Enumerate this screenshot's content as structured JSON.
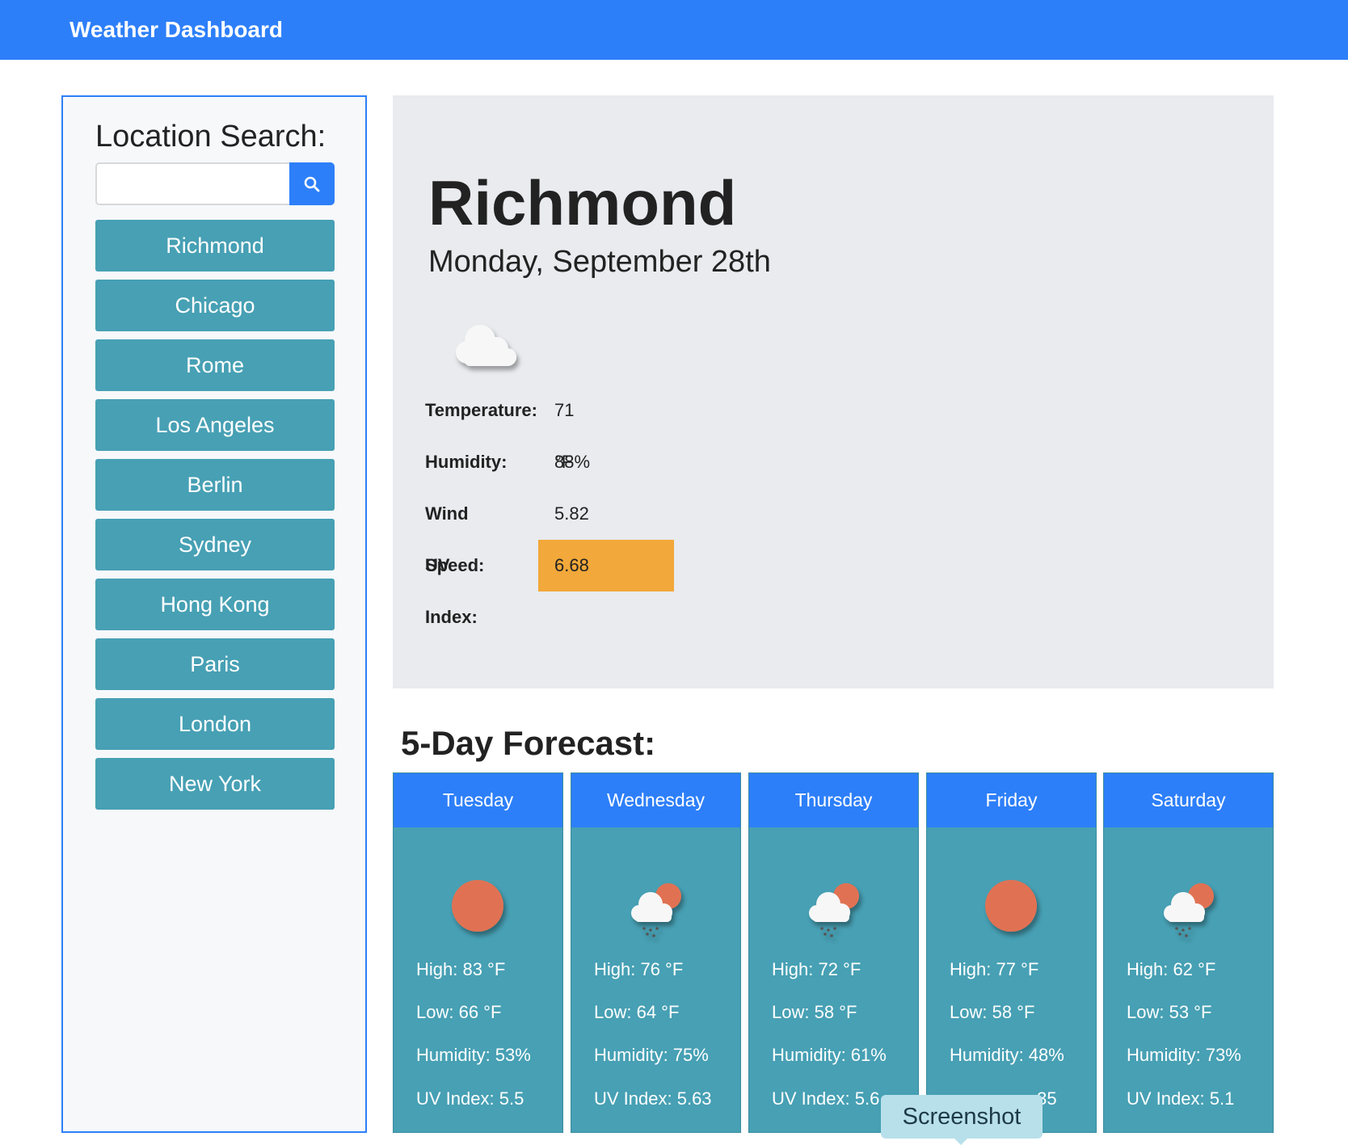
{
  "navbar": {
    "title": "Weather Dashboard"
  },
  "sidebar": {
    "heading": "Location Search:",
    "search": {
      "value": "",
      "placeholder": "",
      "button_icon": "search-icon"
    },
    "cities": [
      "Richmond",
      "Chicago",
      "Rome",
      "Los Angeles",
      "Berlin",
      "Sydney",
      "Hong Kong",
      "Paris",
      "London",
      "New York"
    ]
  },
  "current": {
    "city": "Richmond",
    "date": "Monday, September 28th",
    "icon": "cloud-icon",
    "temperature_label": "Temperature:",
    "temperature": "71 °F",
    "humidity_label": "Humidity:",
    "humidity": "88%",
    "wind_label": "Wind Speed:",
    "wind": "5.82 MPH",
    "uv_label": "UV Index:",
    "uv": "6.68",
    "uv_color": "#f2a83a"
  },
  "forecast": {
    "title": "5-Day Forecast:",
    "days": [
      {
        "day": "Tuesday",
        "icon": "sun-icon",
        "high": "High: 83 °F",
        "low": "Low: 66 °F",
        "humidity": "Humidity: 53%",
        "uv": "UV Index: 5.5"
      },
      {
        "day": "Wednesday",
        "icon": "rain-cloud-sun-icon",
        "high": "High: 76 °F",
        "low": "Low: 64 °F",
        "humidity": "Humidity: 75%",
        "uv": "UV Index: 5.63"
      },
      {
        "day": "Thursday",
        "icon": "rain-cloud-sun-icon",
        "high": "High: 72 °F",
        "low": "Low: 58 °F",
        "humidity": "Humidity: 61%",
        "uv": "UV Index: 5.6"
      },
      {
        "day": "Friday",
        "icon": "sun-icon",
        "high": "High: 77 °F",
        "low": "Low: 58 °F",
        "humidity": "Humidity: 48%",
        "uv": ".35"
      },
      {
        "day": "Saturday",
        "icon": "rain-cloud-sun-icon",
        "high": "High: 62 °F",
        "low": "Low: 53 °F",
        "humidity": "Humidity: 73%",
        "uv": "UV Index: 5.1"
      }
    ]
  },
  "tooltip": {
    "text": "Screenshot"
  },
  "colors": {
    "accent": "#2d7ff9",
    "card": "#47a0b4",
    "sun": "#e07252"
  }
}
